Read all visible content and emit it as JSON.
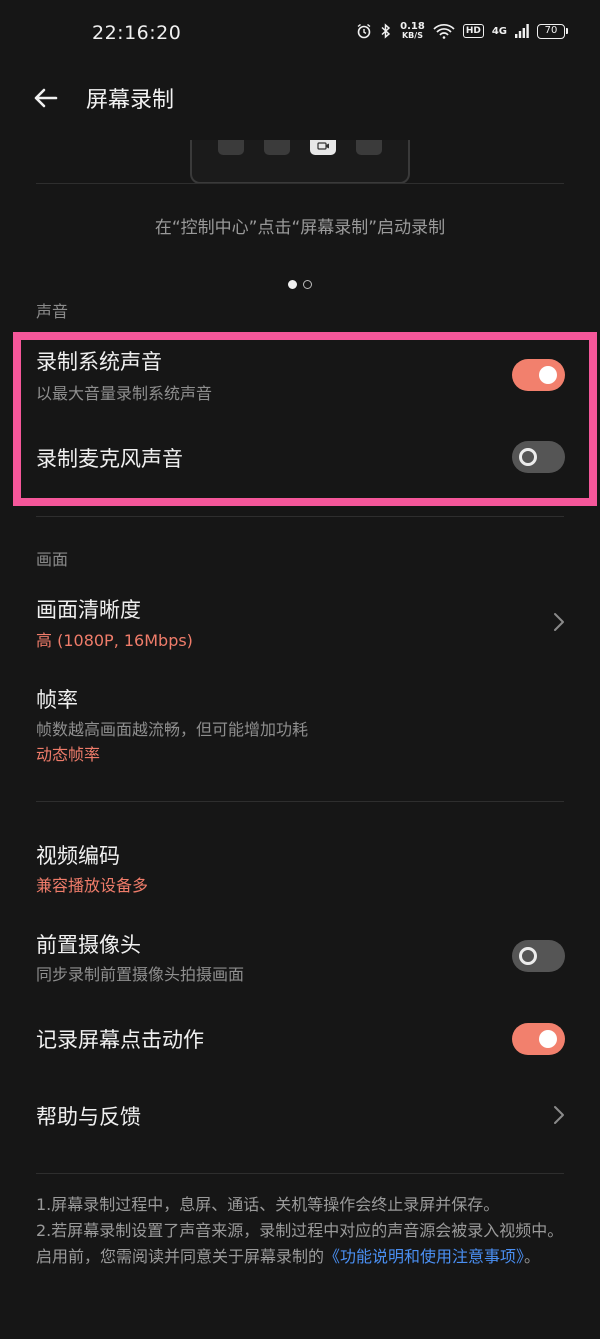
{
  "status_bar": {
    "time": "22:16:20",
    "speed_value": "0.18",
    "speed_unit": "KB/S",
    "hd_badge": "HD",
    "network": "4G",
    "battery": "70"
  },
  "header": {
    "title": "屏幕录制",
    "back_icon": "arrow-left-icon"
  },
  "guide": {
    "hint": "在“控制中心”点击“屏幕录制”启动录制",
    "pages": 2,
    "current_page": 1
  },
  "sound": {
    "label": "声音",
    "system_sound": {
      "title": "录制系统声音",
      "subtitle": "以最大音量录制系统声音",
      "on": true
    },
    "mic_sound": {
      "title": "录制麦克风声音",
      "on": false
    }
  },
  "picture": {
    "label": "画面",
    "resolution": {
      "title": "画面清晰度",
      "value": "高 (1080P, 16Mbps)"
    },
    "frame_rate": {
      "title": "帧率",
      "subtitle": "帧数越高画面越流畅，但可能增加功耗",
      "value": "动态帧率"
    }
  },
  "more": {
    "video_codec": {
      "title": "视频编码",
      "value": "兼容播放设备多"
    },
    "front_camera": {
      "title": "前置摄像头",
      "subtitle": "同步录制前置摄像头拍摄画面",
      "on": false
    },
    "record_taps": {
      "title": "记录屏幕点击动作",
      "on": true
    },
    "help": {
      "title": "帮助与反馈"
    }
  },
  "footnote": {
    "line1": "1.屏幕录制过程中，息屏、通话、关机等操作会终止录屏并保存。",
    "line2_pre": "2.若屏幕录制设置了声音来源，录制过程中对应的声音源会被录入视频中。启用前，您需阅读并同意关于屏幕录制的",
    "link": "《功能说明和使用注意事项》",
    "line2_post": "。"
  },
  "colors": {
    "accent": "#f2806d",
    "value_text": "#ef7c6a",
    "link": "#4a8ff2",
    "highlight_border": "#f5579a",
    "background": "#161616"
  }
}
